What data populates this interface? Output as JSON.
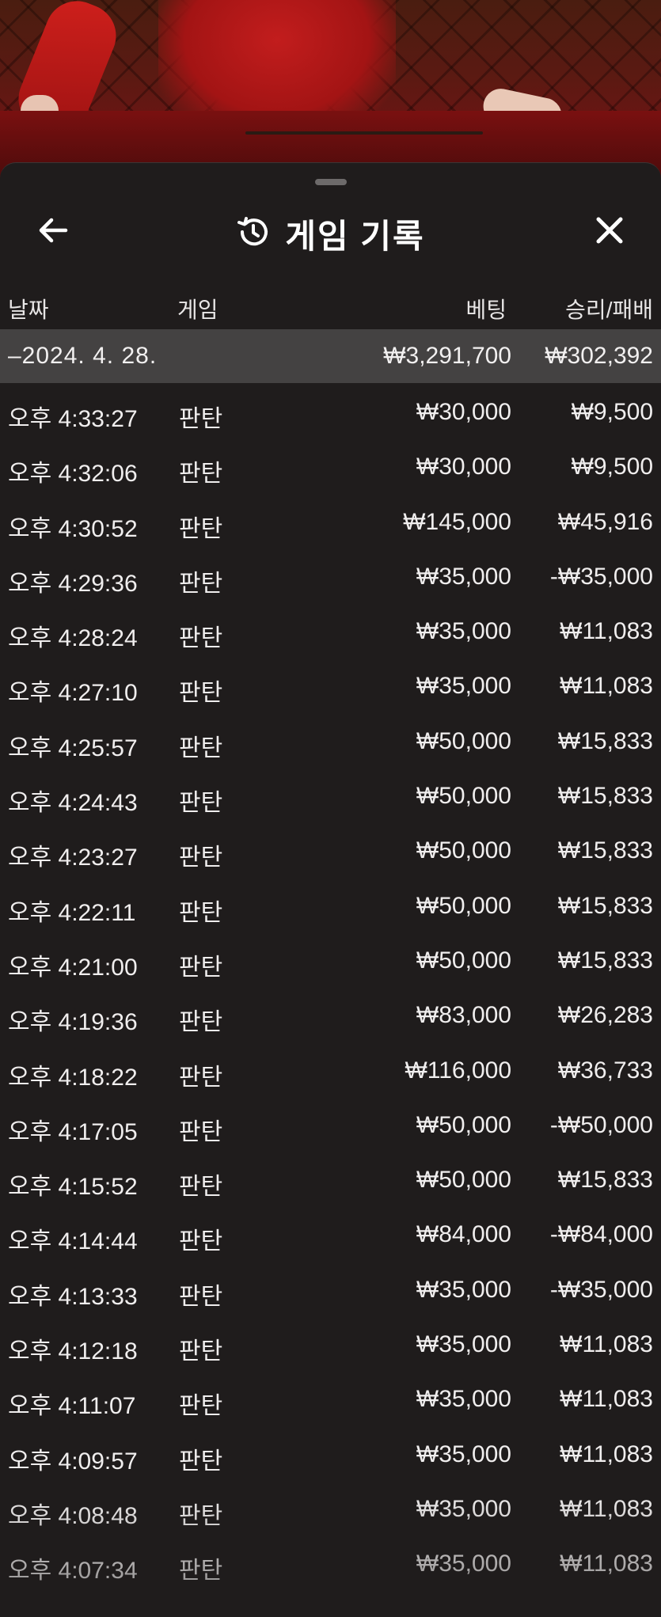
{
  "colors": {
    "sheet_bg": "#1f1c1c",
    "date_row_bg": "#444242",
    "text": "#f0eeee",
    "dealer_red": "#c21d1d"
  },
  "header": {
    "title": "게임 기록",
    "back_icon": "arrow-left-icon",
    "history_icon": "history-clock-icon",
    "close_icon": "close-icon"
  },
  "columns": {
    "date": "날짜",
    "game": "게임",
    "bet": "베팅",
    "result": "승리/패배"
  },
  "date_group": {
    "label": "–2024. 4. 28.",
    "total_bet": "₩3,291,700",
    "total_result": "₩302,392"
  },
  "rows": [
    {
      "time": "오후 4:33:27",
      "game": "판탄",
      "bet": "₩30,000",
      "result": "₩9,500"
    },
    {
      "time": "오후 4:32:06",
      "game": "판탄",
      "bet": "₩30,000",
      "result": "₩9,500"
    },
    {
      "time": "오후 4:30:52",
      "game": "판탄",
      "bet": "₩145,000",
      "result": "₩45,916"
    },
    {
      "time": "오후 4:29:36",
      "game": "판탄",
      "bet": "₩35,000",
      "result": "-₩35,000"
    },
    {
      "time": "오후 4:28:24",
      "game": "판탄",
      "bet": "₩35,000",
      "result": "₩11,083"
    },
    {
      "time": "오후 4:27:10",
      "game": "판탄",
      "bet": "₩35,000",
      "result": "₩11,083"
    },
    {
      "time": "오후 4:25:57",
      "game": "판탄",
      "bet": "₩50,000",
      "result": "₩15,833"
    },
    {
      "time": "오후 4:24:43",
      "game": "판탄",
      "bet": "₩50,000",
      "result": "₩15,833"
    },
    {
      "time": "오후 4:23:27",
      "game": "판탄",
      "bet": "₩50,000",
      "result": "₩15,833"
    },
    {
      "time": "오후 4:22:11",
      "game": "판탄",
      "bet": "₩50,000",
      "result": "₩15,833"
    },
    {
      "time": "오후 4:21:00",
      "game": "판탄",
      "bet": "₩50,000",
      "result": "₩15,833"
    },
    {
      "time": "오후 4:19:36",
      "game": "판탄",
      "bet": "₩83,000",
      "result": "₩26,283"
    },
    {
      "time": "오후 4:18:22",
      "game": "판탄",
      "bet": "₩116,000",
      "result": "₩36,733"
    },
    {
      "time": "오후 4:17:05",
      "game": "판탄",
      "bet": "₩50,000",
      "result": "-₩50,000"
    },
    {
      "time": "오후 4:15:52",
      "game": "판탄",
      "bet": "₩50,000",
      "result": "₩15,833"
    },
    {
      "time": "오후 4:14:44",
      "game": "판탄",
      "bet": "₩84,000",
      "result": "-₩84,000"
    },
    {
      "time": "오후 4:13:33",
      "game": "판탄",
      "bet": "₩35,000",
      "result": "-₩35,000"
    },
    {
      "time": "오후 4:12:18",
      "game": "판탄",
      "bet": "₩35,000",
      "result": "₩11,083"
    },
    {
      "time": "오후 4:11:07",
      "game": "판탄",
      "bet": "₩35,000",
      "result": "₩11,083"
    },
    {
      "time": "오후 4:09:57",
      "game": "판탄",
      "bet": "₩35,000",
      "result": "₩11,083"
    },
    {
      "time": "오후 4:08:48",
      "game": "판탄",
      "bet": "₩35,000",
      "result": "₩11,083"
    },
    {
      "time": "오후 4:07:34",
      "game": "판탄",
      "bet": "₩35,000",
      "result": "₩11,083"
    }
  ]
}
